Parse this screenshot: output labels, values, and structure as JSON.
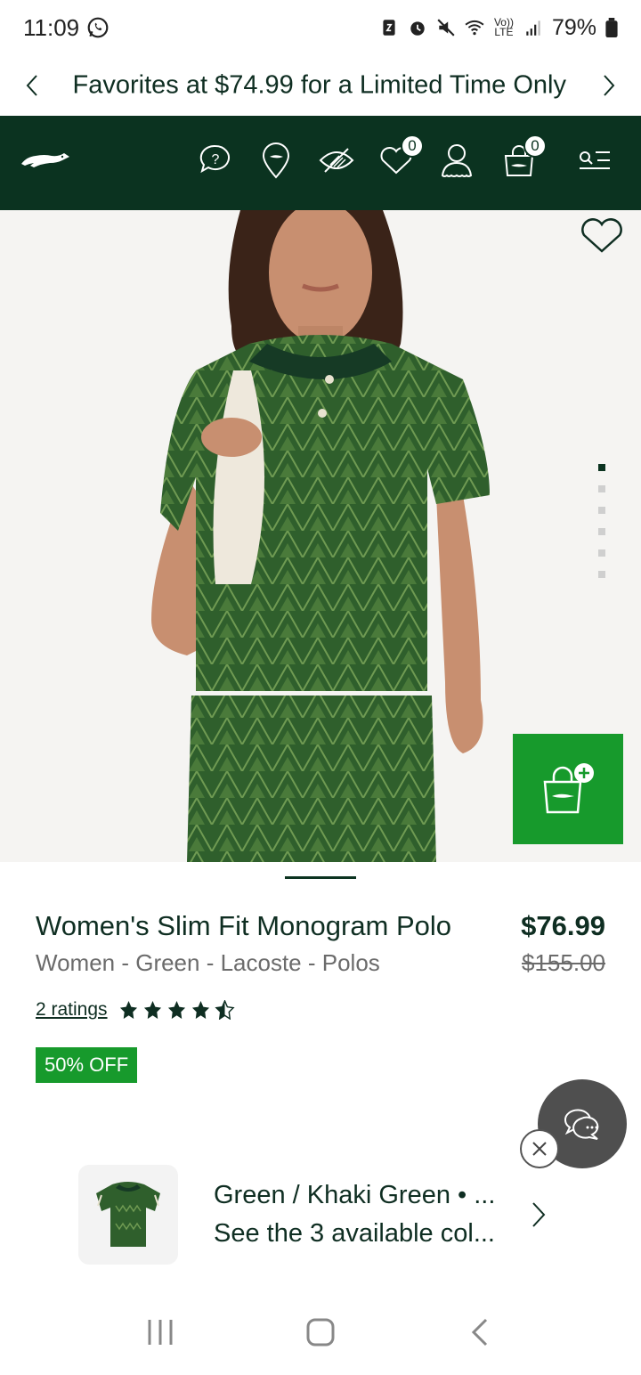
{
  "status_bar": {
    "time": "11:09",
    "battery": "79%",
    "volte": "Vo)) LTE"
  },
  "promo": {
    "message": "Favorites at $74.99 for a Limited Time Only"
  },
  "header": {
    "icons": [
      "help-icon",
      "store-locator-icon",
      "accessibility-icon",
      "wishlist-icon",
      "account-icon",
      "cart-icon",
      "menu-icon"
    ],
    "wishlist_count": "0",
    "cart_count": "0",
    "brand_color": "#0b3320"
  },
  "gallery": {
    "image_count": 6,
    "active_index": 0
  },
  "product": {
    "name": "Women's Slim Fit Monogram Polo",
    "category": "Women - Green - Lacoste - Polos",
    "price": "$76.99",
    "original_price": "$155.00",
    "ratings_label": "2 ratings",
    "rating_value": 4.5,
    "discount": "50% OFF",
    "accent_color": "#179a2c"
  },
  "color_selector": {
    "color_name": "Green / Khaki Green • ...",
    "available": "See the 3 available col..."
  }
}
